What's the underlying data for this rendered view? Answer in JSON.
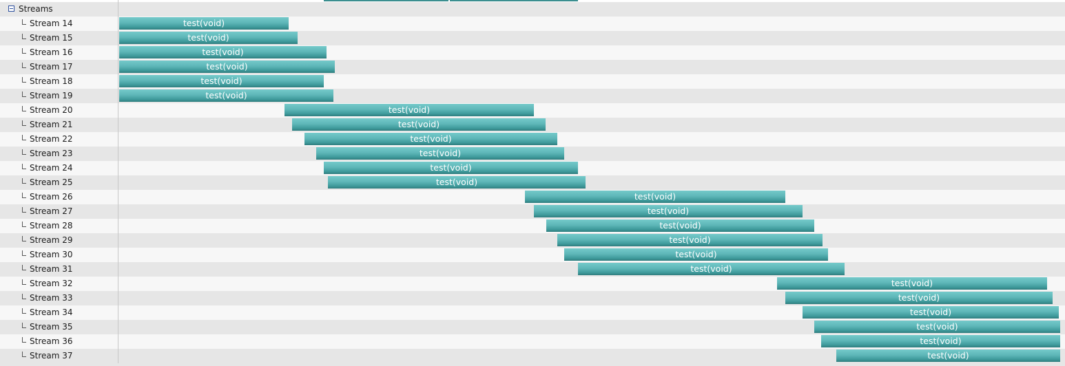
{
  "group": {
    "label": "Streams",
    "expanded": true
  },
  "colors": {
    "bar": "#5eb7b8",
    "bar_text": "#ffffff",
    "row_even": "#e6e6e6",
    "row_odd": "#f7f7f7"
  },
  "icons": {
    "collapse": "minus-box-icon",
    "branch": "tree-branch-icon"
  },
  "streams": [
    {
      "label": "Stream 14",
      "kernel": "test(void)"
    },
    {
      "label": "Stream 15",
      "kernel": "test(void)"
    },
    {
      "label": "Stream 16",
      "kernel": "test(void)"
    },
    {
      "label": "Stream 17",
      "kernel": "test(void)"
    },
    {
      "label": "Stream 18",
      "kernel": "test(void)"
    },
    {
      "label": "Stream 19",
      "kernel": "test(void)"
    },
    {
      "label": "Stream 20",
      "kernel": "test(void)"
    },
    {
      "label": "Stream 21",
      "kernel": "test(void)"
    },
    {
      "label": "Stream 22",
      "kernel": "test(void)"
    },
    {
      "label": "Stream 23",
      "kernel": "test(void)"
    },
    {
      "label": "Stream 24",
      "kernel": "test(void)"
    },
    {
      "label": "Stream 25",
      "kernel": "test(void)"
    },
    {
      "label": "Stream 26",
      "kernel": "test(void)"
    },
    {
      "label": "Stream 27",
      "kernel": "test(void)"
    },
    {
      "label": "Stream 28",
      "kernel": "test(void)"
    },
    {
      "label": "Stream 29",
      "kernel": "test(void)"
    },
    {
      "label": "Stream 30",
      "kernel": "test(void)"
    },
    {
      "label": "Stream 31",
      "kernel": "test(void)"
    },
    {
      "label": "Stream 32",
      "kernel": "test(void)"
    },
    {
      "label": "Stream 33",
      "kernel": "test(void)"
    },
    {
      "label": "Stream 34",
      "kernel": "test(void)"
    },
    {
      "label": "Stream 35",
      "kernel": "test(void)"
    },
    {
      "label": "Stream 36",
      "kernel": "test(void)"
    },
    {
      "label": "Stream 37",
      "kernel": "test(void)"
    }
  ]
}
